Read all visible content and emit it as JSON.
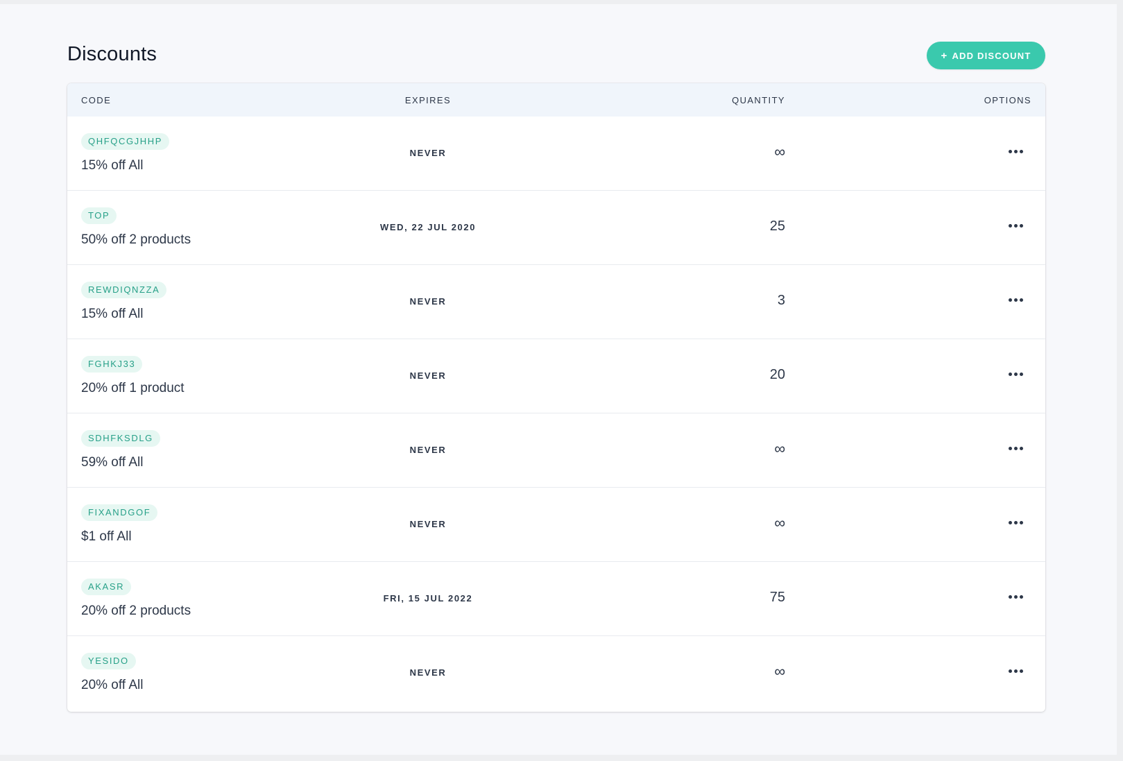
{
  "page": {
    "title": "Discounts"
  },
  "toolbar": {
    "add_label": "ADD DISCOUNT",
    "add_icon": "plus-icon"
  },
  "table": {
    "columns": {
      "code": "CODE",
      "expires": "EXPIRES",
      "quantity": "QUANTITY",
      "options": "OPTIONS"
    },
    "rows": [
      {
        "code": "QHFQCGJHHP",
        "description": "15% off All",
        "expires": "NEVER",
        "quantity": "∞"
      },
      {
        "code": "TOP",
        "description": "50% off 2 products",
        "expires": "WED, 22 JUL 2020",
        "quantity": "25"
      },
      {
        "code": "REWDIQNZZA",
        "description": "15% off All",
        "expires": "NEVER",
        "quantity": "3"
      },
      {
        "code": "FGHKJ33",
        "description": "20% off 1 product",
        "expires": "NEVER",
        "quantity": "20"
      },
      {
        "code": "SDHFKSDLG",
        "description": "59% off All",
        "expires": "NEVER",
        "quantity": "∞"
      },
      {
        "code": "FIXANDGOF",
        "description": "$1 off All",
        "expires": "NEVER",
        "quantity": "∞"
      },
      {
        "code": "AKASR",
        "description": "20% off 2 products",
        "expires": "FRI, 15 JUL 2022",
        "quantity": "75"
      },
      {
        "code": "YESIDO",
        "description": "20% off All",
        "expires": "NEVER",
        "quantity": "∞"
      }
    ]
  },
  "colors": {
    "accent": "#3ac9ad",
    "badge_bg": "#e6f7f2",
    "badge_text": "#27a088",
    "text": "#2d3748",
    "header_bg": "#f0f5fb"
  }
}
